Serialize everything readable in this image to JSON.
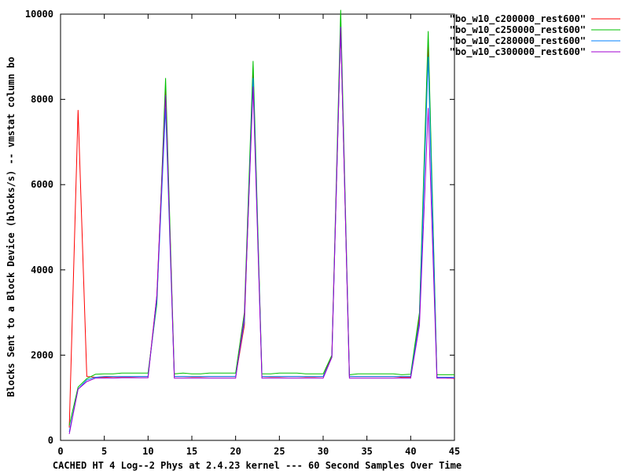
{
  "chart_data": {
    "type": "line",
    "xlabel": "CACHED HT 4 Log--2 Phys at 2.4.23 kernel --- 60 Second Samples Over Time",
    "ylabel": "Blocks Sent to a Block Device (blocks/s) -- vmstat column bo",
    "xlim": [
      0,
      45
    ],
    "ylim": [
      0,
      10000
    ],
    "xticks": [
      0,
      5,
      10,
      15,
      20,
      25,
      30,
      35,
      40,
      45
    ],
    "yticks": [
      0,
      2000,
      4000,
      6000,
      8000,
      10000
    ],
    "grid": false,
    "legend_position": "top-right",
    "x": [
      1,
      2,
      3,
      4,
      5,
      6,
      7,
      8,
      9,
      10,
      11,
      12,
      13,
      14,
      15,
      16,
      17,
      18,
      19,
      20,
      21,
      22,
      23,
      24,
      25,
      26,
      27,
      28,
      29,
      30,
      31,
      32,
      33,
      34,
      35,
      36,
      37,
      38,
      39,
      40,
      41,
      42,
      43,
      44,
      45
    ],
    "series": [
      {
        "name": "\"bo_w10_c200000_rest600\"",
        "color": "#ff0000",
        "values": [
          300,
          7750,
          1500,
          1480,
          1480,
          1490,
          1490,
          1490,
          1500,
          1500,
          3400,
          8250,
          1500,
          1500,
          1490,
          1490,
          1500,
          1500,
          1500,
          1500,
          2700,
          8650,
          1500,
          1490,
          1490,
          1500,
          1500,
          1490,
          1490,
          1500,
          2000,
          9700,
          1500,
          1500,
          1500,
          1500,
          1500,
          1500,
          1480,
          1480,
          2900,
          9300,
          1480,
          1480,
          1450
        ]
      },
      {
        "name": "\"bo_w10_c250000_rest600\"",
        "color": "#00c000",
        "values": [
          350,
          1250,
          1450,
          1550,
          1560,
          1560,
          1580,
          1580,
          1580,
          1580,
          3200,
          8500,
          1560,
          1580,
          1560,
          1560,
          1580,
          1580,
          1580,
          1580,
          3000,
          8900,
          1560,
          1560,
          1580,
          1580,
          1580,
          1560,
          1560,
          1560,
          2000,
          10100,
          1540,
          1560,
          1560,
          1560,
          1560,
          1560,
          1540,
          1550,
          3000,
          9600,
          1540,
          1540,
          1540
        ]
      },
      {
        "name": "\"bo_w10_c280000_rest600\"",
        "color": "#0080ff",
        "values": [
          200,
          1200,
          1420,
          1480,
          1500,
          1500,
          1500,
          1500,
          1500,
          1500,
          3300,
          7800,
          1500,
          1500,
          1500,
          1500,
          1500,
          1500,
          1500,
          1500,
          2800,
          8500,
          1500,
          1500,
          1500,
          1500,
          1500,
          1500,
          1500,
          1500,
          1950,
          9700,
          1500,
          1500,
          1500,
          1500,
          1500,
          1500,
          1500,
          1500,
          2800,
          9000,
          1480,
          1480,
          1480
        ]
      },
      {
        "name": "\"bo_w10_c300000_rest600\"",
        "color": "#a000d0",
        "values": [
          150,
          1200,
          1380,
          1460,
          1460,
          1460,
          1470,
          1470,
          1470,
          1470,
          3400,
          8100,
          1460,
          1460,
          1460,
          1460,
          1460,
          1460,
          1460,
          1460,
          2900,
          8300,
          1460,
          1460,
          1460,
          1460,
          1460,
          1460,
          1460,
          1460,
          1950,
          9700,
          1460,
          1460,
          1460,
          1460,
          1460,
          1460,
          1460,
          1460,
          2700,
          7800,
          1460,
          1460,
          1460
        ]
      }
    ]
  }
}
